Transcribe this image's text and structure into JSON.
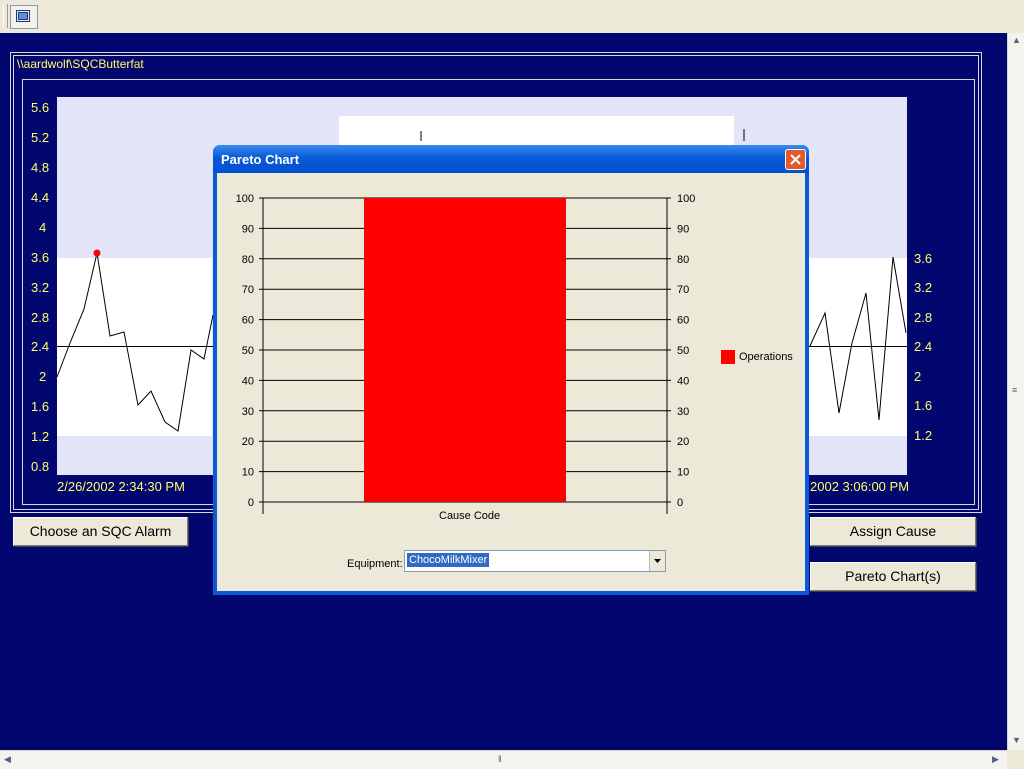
{
  "toolbar": {
    "icon": "window-icon"
  },
  "sqc": {
    "path": "\\\\aardwolf\\SQCButterfat",
    "y_left_ticks": [
      "5.6",
      "5.2",
      "4.8",
      "4.4",
      "4",
      "3.6",
      "3.2",
      "2.8",
      "2.4",
      "2",
      "1.6",
      "1.2",
      "0.8"
    ],
    "y_right_ticks": [
      "3.6",
      "3.2",
      "2.8",
      "2.4",
      "2",
      "1.6",
      "1.2"
    ],
    "x_start": "2/26/2002 2:34:30 PM",
    "x_end": "2002 3:06:00 PM",
    "colors": {
      "background": "#02066f",
      "label": "#ffff66",
      "alarm_point": "#ff0000"
    }
  },
  "buttons": {
    "choose_alarm": "Choose an SQC Alarm",
    "assign_cause": "Assign Cause",
    "pareto_charts": "Pareto Chart(s)"
  },
  "dialog": {
    "title": "Pareto Chart",
    "equipment_label": "Equipment:",
    "equipment_value": "ChocoMilkMixer"
  },
  "chart_data": {
    "type": "bar",
    "title": "",
    "categories": [
      ""
    ],
    "series": [
      {
        "name": "Operations",
        "values": [
          100
        ]
      }
    ],
    "xlabel": "Cause Code",
    "ylim": [
      0,
      100
    ],
    "y_ticks": [
      100,
      90,
      80,
      70,
      60,
      50,
      40,
      30,
      20,
      10,
      0
    ],
    "y2_ticks": [
      100,
      90,
      80,
      70,
      60,
      50,
      40,
      30,
      20,
      10,
      0
    ],
    "grid": true,
    "legend": "right",
    "bar_color": "#ff0000"
  }
}
